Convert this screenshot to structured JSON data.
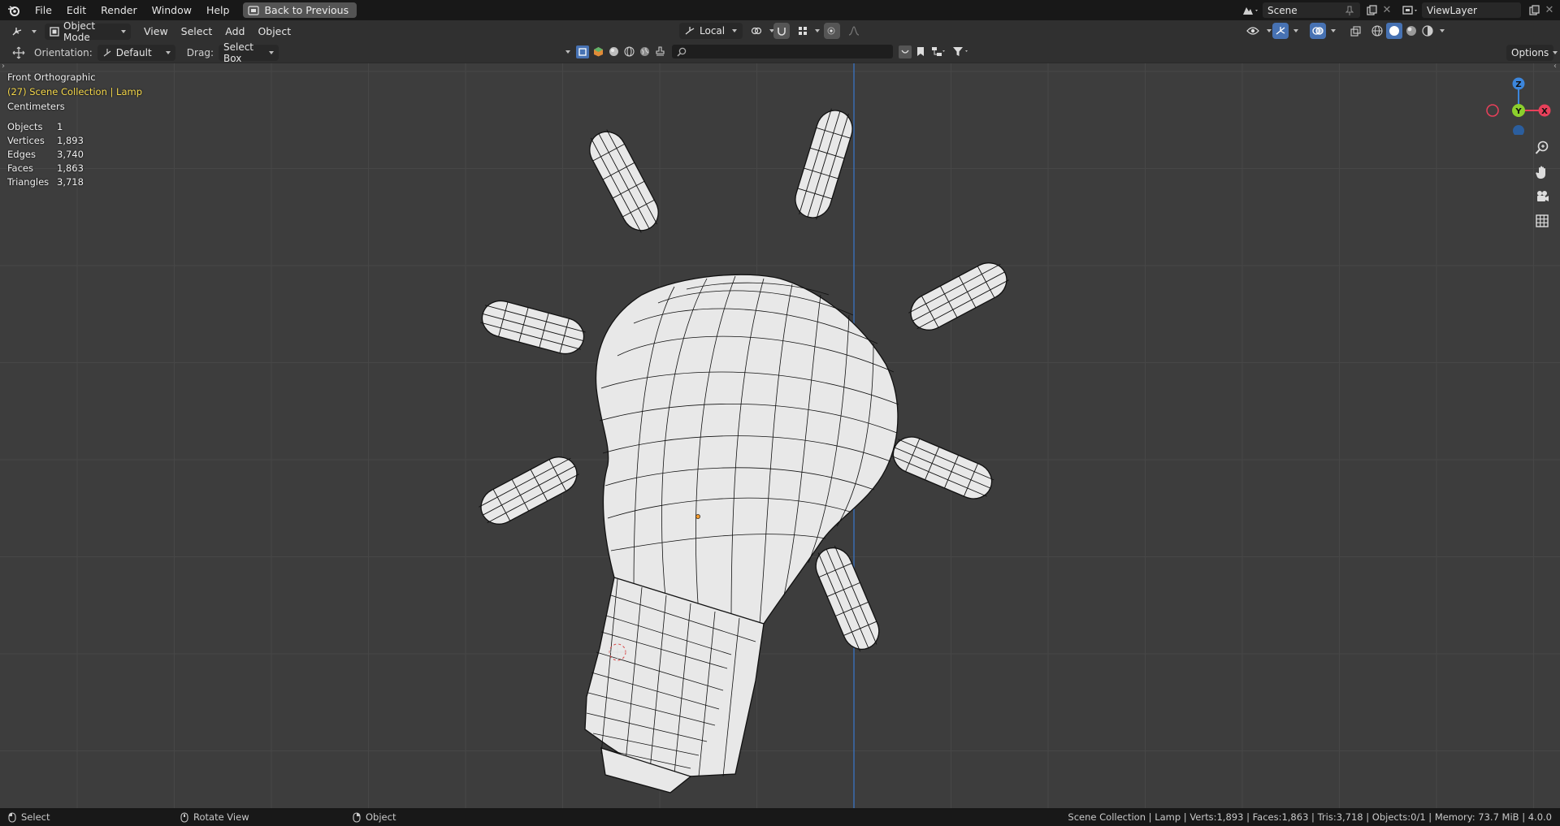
{
  "menubar": {
    "items": [
      "File",
      "Edit",
      "Render",
      "Window",
      "Help"
    ],
    "back_button": "Back to Previous",
    "scene": "Scene",
    "view_layer": "ViewLayer"
  },
  "header": {
    "mode": "Object Mode",
    "menus": [
      "View",
      "Select",
      "Add",
      "Object"
    ],
    "pivot": "Local"
  },
  "toolbar": {
    "orientation_label": "Orientation:",
    "orientation_value": "Default",
    "drag_label": "Drag:",
    "drag_value": "Select Box",
    "options": "Options"
  },
  "viewport": {
    "view_name": "Front Orthographic",
    "collection": "(27) Scene Collection | Lamp",
    "units": "Centimeters",
    "stats": [
      {
        "label": "Objects",
        "value": "1"
      },
      {
        "label": "Vertices",
        "value": "1,893"
      },
      {
        "label": "Edges",
        "value": "3,740"
      },
      {
        "label": "Faces",
        "value": "1,863"
      },
      {
        "label": "Triangles",
        "value": "3,718"
      }
    ],
    "gizmo": {
      "z": "Z",
      "y": "Y",
      "x": "X"
    }
  },
  "statusbar": {
    "select": "Select",
    "rotate": "Rotate View",
    "object": "Object",
    "info": "Scene Collection | Lamp | Verts:1,893 | Faces:1,863 | Tris:3,718 | Objects:0/1 | Memory: 73.7 MiB | 4.0.0"
  },
  "colors": {
    "menubar_bg": "#181818",
    "header_bg": "#303030",
    "viewport_bg": "#3d3d3d",
    "grid_line": "#474747",
    "axis_z_blue": "#3a6fb8",
    "active_text_yellow": "#f5d84b",
    "mesh_fill": "#e8e8e8",
    "mesh_wire": "#111111",
    "gizmo_x": "#e8405a",
    "gizmo_y": "#8ccf2c",
    "gizmo_z": "#3c86dc",
    "accent_blue": "#4772b3"
  },
  "icons": [
    "blender-logo-icon",
    "editor-type-icon",
    "object-mode-icon",
    "transform-pivot-icon",
    "snap-icon",
    "proportional-edit-icon",
    "visibility-icon",
    "gizmo-icon",
    "overlay-icon",
    "xray-icon",
    "shading-wireframe-icon",
    "shading-solid-icon",
    "shading-material-icon",
    "shading-rendered-icon",
    "zoom-icon",
    "pan-hand-icon",
    "camera-icon",
    "grid-ortho-icon",
    "mouse-left-icon",
    "mouse-middle-icon",
    "mouse-right-icon"
  ]
}
